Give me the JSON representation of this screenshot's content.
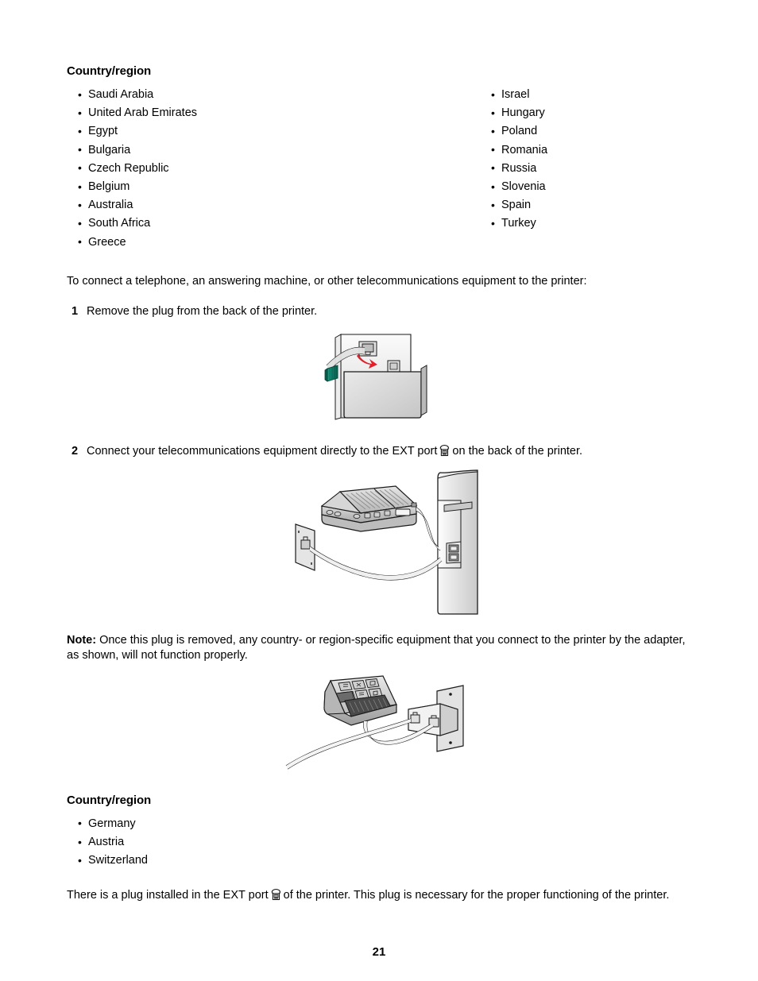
{
  "document": {
    "page_number": "21"
  },
  "section_one": {
    "heading": "Country/region",
    "countries_left": [
      "Saudi Arabia",
      "United Arab Emirates",
      "Egypt",
      "Bulgaria",
      "Czech Republic",
      "Belgium",
      "Australia",
      "South Africa",
      "Greece"
    ],
    "countries_right": [
      "Israel",
      "Hungary",
      "Poland",
      "Romania",
      "Russia",
      "Slovenia",
      "Spain",
      "Turkey"
    ]
  },
  "instructions": {
    "intro": "To connect a telephone, an answering machine, or other telecommunications equipment to the printer:",
    "steps": [
      {
        "number": "1",
        "text": "Remove the plug from the back of the printer."
      },
      {
        "number": "2",
        "text_before_icon": "Connect your telecommunications equipment directly to the EXT port",
        "icon": "telephone-ext-port-icon",
        "text_after_icon": "on the back of the printer."
      }
    ]
  },
  "note": {
    "label": "Note:",
    "text": "Once this plug is removed, any country- or region-specific equipment that you connect to the printer by the adapter, as shown, will not function properly."
  },
  "section_two": {
    "heading": "Country/region",
    "countries": [
      "Germany",
      "Austria",
      "Switzerland"
    ]
  },
  "closing": {
    "text_before_icon": "There is a plug installed in the EXT port",
    "icon": "telephone-ext-port-icon",
    "text_after_icon": "of the printer. This plug is necessary for the proper functioning of the printer."
  },
  "figures": {
    "figure_1": {
      "name": "printer-back-remove-plug-illustration",
      "alt": "Printer back panel showing a telephone cable and green plug being pulled out of the port, indicated by a red arrow"
    },
    "figure_2": {
      "name": "answering-machine-to-printer-illustration",
      "alt": "Answering machine connected by cables to the printer rear ports and to a wall telephone jack"
    },
    "figure_3": {
      "name": "telephone-adapter-wall-illustration",
      "alt": "Telephone keypad device connected by a cord to an adapter box mounted on a wall plate"
    }
  },
  "colors": {
    "plug_green": "#12806f",
    "arrow_red": "#e3202a",
    "line": "#1a1a1a",
    "fill_light": "#f2f2f2",
    "fill_mid": "#d4d4d4",
    "fill_dark": "#9a9a9a"
  }
}
